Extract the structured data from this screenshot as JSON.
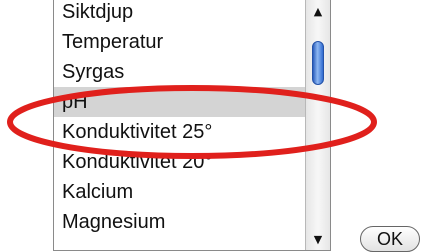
{
  "list": {
    "items": [
      "Siktdjup",
      "Temperatur",
      "Syrgas",
      "pH",
      "Konduktivitet 25°",
      "Konduktivitet 20°",
      "Kalcium",
      "Magnesium"
    ],
    "selected_index": 3
  },
  "scrollbar": {
    "up_arrow": "▲",
    "down_arrow": "▼"
  },
  "ok_button": {
    "label": "OK"
  },
  "annotation": {
    "color": "#e0201c",
    "shape": "ellipse"
  }
}
